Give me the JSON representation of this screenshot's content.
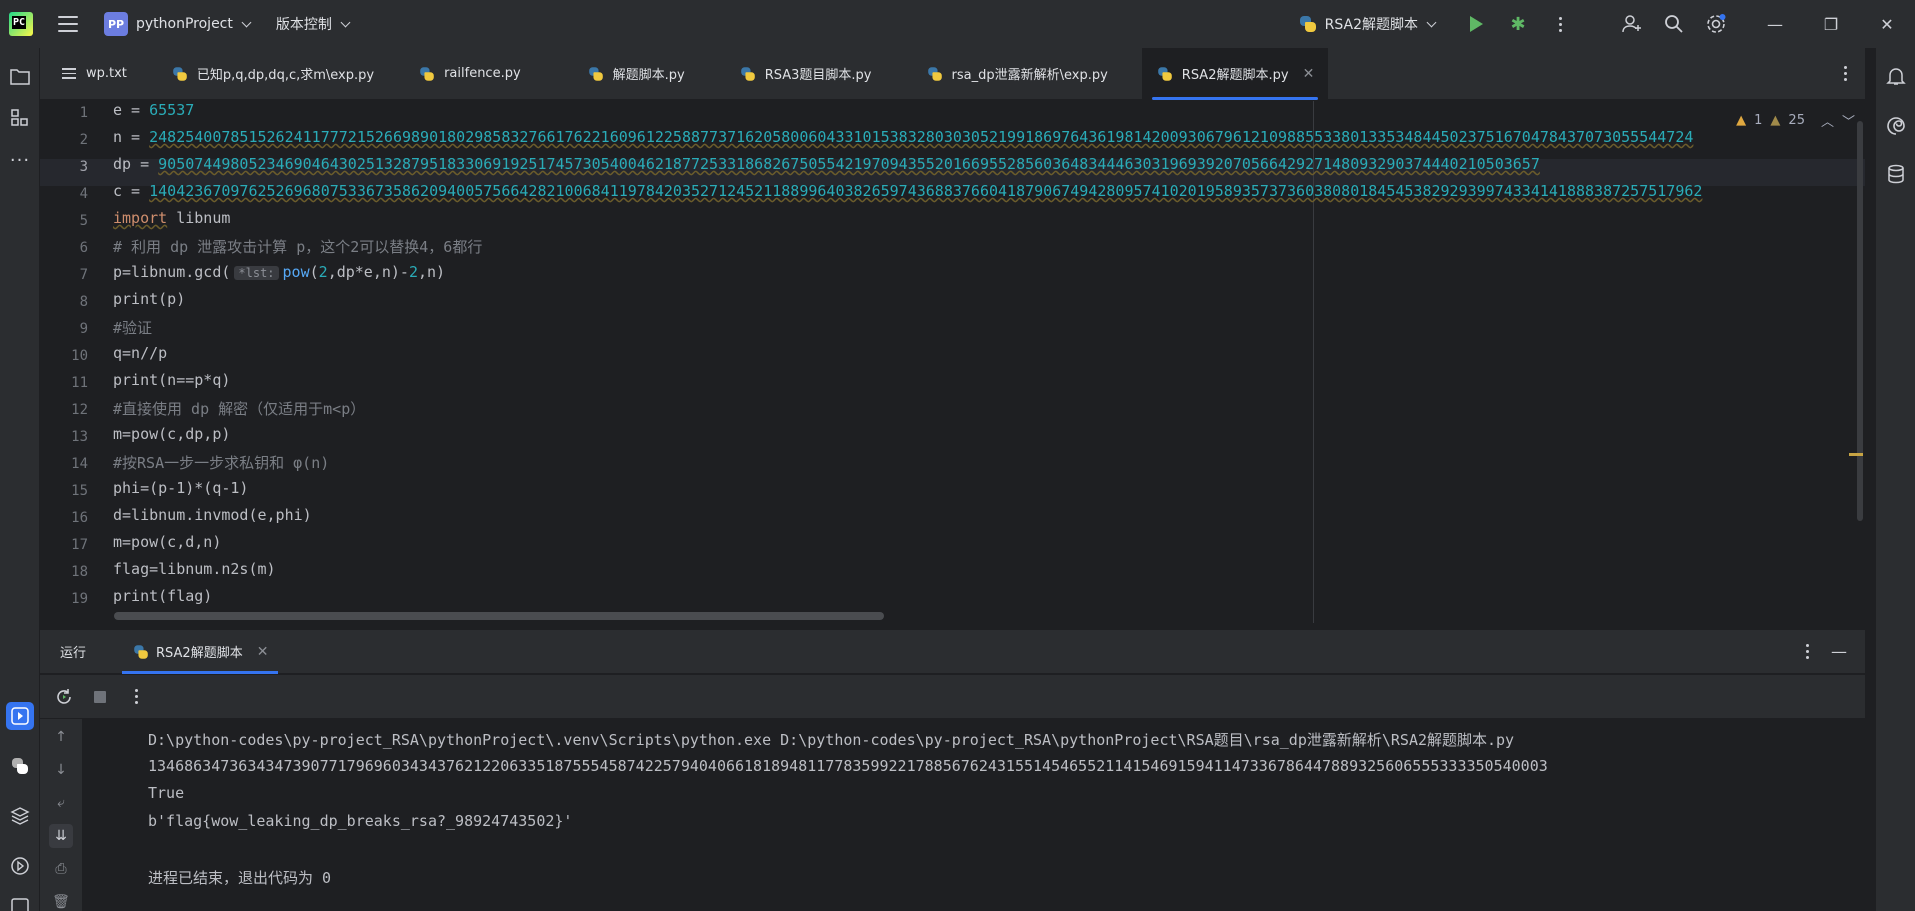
{
  "titlebar": {
    "project_badge": "PP",
    "project_name": "pythonProject",
    "vcs_label": "版本控制",
    "run_config": "RSA2解题脚本"
  },
  "tabs": [
    {
      "label": "wp.txt"
    },
    {
      "label": "已知p,q,dp,dq,c,求m\\exp.py"
    },
    {
      "label": "railfence.py"
    },
    {
      "label": "解题脚本.py"
    },
    {
      "label": "RSA3题目脚本.py"
    },
    {
      "label": "rsa_dp泄露新解析\\exp.py"
    },
    {
      "label": "RSA2解题脚本.py"
    }
  ],
  "editor": {
    "inspections": {
      "warnings_a": "1",
      "warnings_b": "25"
    },
    "inline_hint": "*lst:",
    "lines": [
      {
        "n": "1",
        "pre": "e = ",
        "val": "65537"
      },
      {
        "n": "2",
        "pre": "n = ",
        "val": "248254007851526241177721526698901802985832766176221609612258877371620580060433101538328030305219918697643619814200930679612109885533801335348445023751670478437073055544724"
      },
      {
        "n": "3",
        "pre": "dp = ",
        "val": "90507449805234690464302513287951833069192517457305400462187725331868267505542197094355201669552856036483444630319693920705664292714809329037444021050365​7"
      },
      {
        "n": "4",
        "pre": "c = ",
        "val": "1404236709762526968075336735862094005756642821006841197842035271245211889964038265974368837660418790674942809574102019589357373603808018454538292939974334141888387257517962"
      },
      {
        "n": "5",
        "kw": "import",
        "rest": " libnum"
      },
      {
        "n": "6",
        "comment": "# 利用 dp 泄露攻击计算 p，这个2可以替换4，6都行"
      },
      {
        "n": "7"
      },
      {
        "n": "8",
        "code": "print(p)"
      },
      {
        "n": "9",
        "comment": "#验证"
      },
      {
        "n": "10",
        "code": "q=n//p"
      },
      {
        "n": "11",
        "code": "print(n==p*q)"
      },
      {
        "n": "12",
        "comment": "#直接使用 dp 解密（仅适用于m<p）"
      },
      {
        "n": "13",
        "code": "m=pow(c,dp,p)"
      },
      {
        "n": "14",
        "comment": "#按RSA一步一步求私钥和 φ(n)"
      },
      {
        "n": "15",
        "code": "phi=(p-1)*(q-1)"
      },
      {
        "n": "16",
        "code": "d=libnum.invmod(e,phi)"
      },
      {
        "n": "17",
        "code": "m=pow(c,d,n)"
      },
      {
        "n": "18",
        "code": "flag=libnum.n2s(m)"
      },
      {
        "n": "19",
        "code": "print(flag)"
      }
    ]
  },
  "run_panel": {
    "title": "运行",
    "tab_label": "RSA2解题脚本",
    "output": [
      "D:\\python-codes\\py-project_RSA\\pythonProject\\.venv\\Scripts\\python.exe D:\\python-codes\\py-project_RSA\\pythonProject\\RSA题目\\rsa_dp泄露新解析\\RSA2解题脚本.py",
      "13468634736343473907717969603434376212206335187555458742257940406618189481177835992217885676243155145465521141546915941147336786447889325606555333350540003",
      "True",
      "b'flag{wow_leaking_dp_breaks_rsa?_98924743502}'",
      "",
      "进程已结束，退出代码为 0"
    ]
  }
}
